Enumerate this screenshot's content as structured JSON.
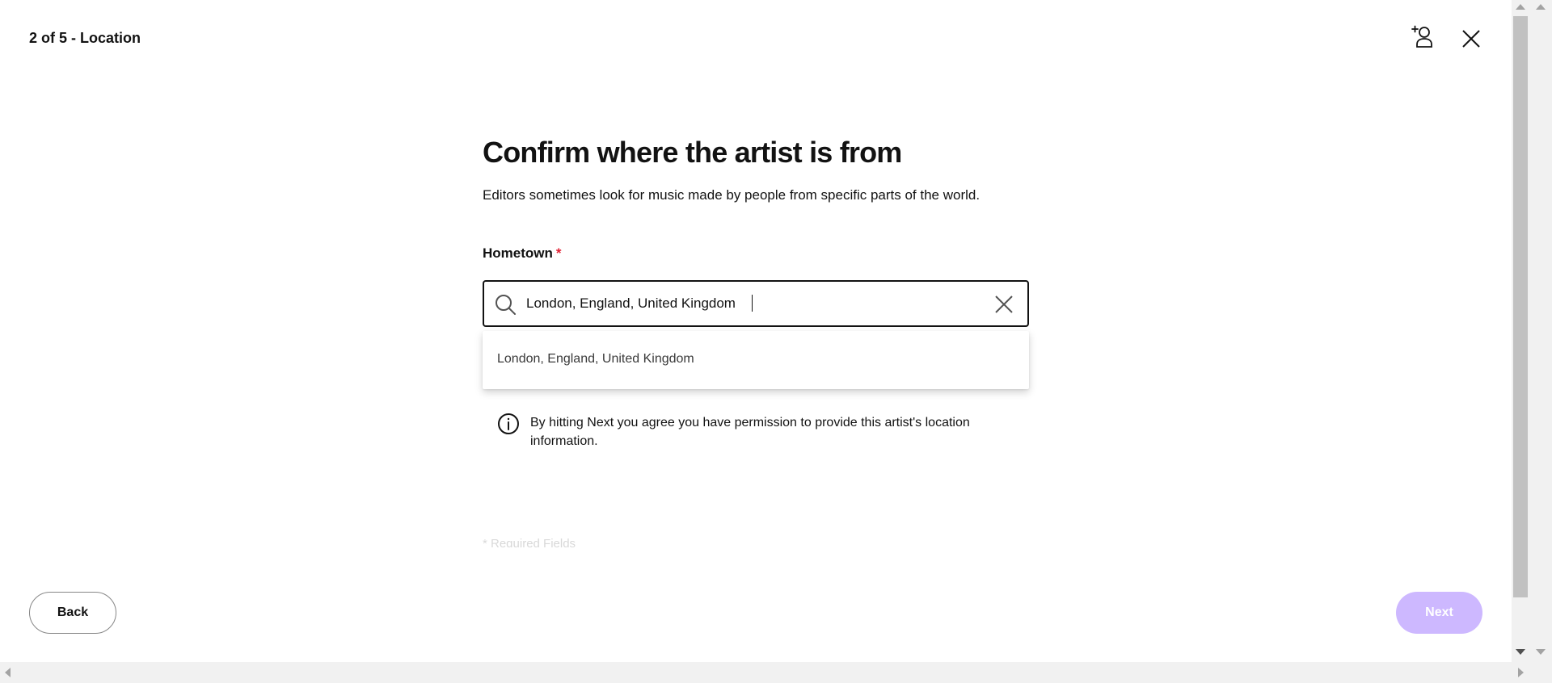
{
  "header": {
    "step_title": "2 of 5 - Location",
    "add_user_icon": "add-user-icon",
    "close_icon": "close-icon"
  },
  "main": {
    "heading": "Confirm where the artist is from",
    "subtitle": "Editors sometimes look for music made by people from specific parts of the world.",
    "hometown": {
      "label": "Hometown",
      "required_marker": "*",
      "value": "London, England, United Kingdom",
      "search_icon": "search-icon",
      "clear_icon": "clear-icon"
    },
    "suggestions": [
      "London, England, United Kingdom"
    ],
    "info": {
      "icon": "info-icon",
      "text": "By hitting Next you agree you have permission to provide this artist's location information."
    },
    "required_note": "* Required Fields"
  },
  "footer": {
    "back_label": "Back",
    "next_label": "Next"
  },
  "colors": {
    "text": "#121212",
    "required": "#e22134",
    "next_disabled": "#cdb8ff",
    "border": "#878787"
  }
}
